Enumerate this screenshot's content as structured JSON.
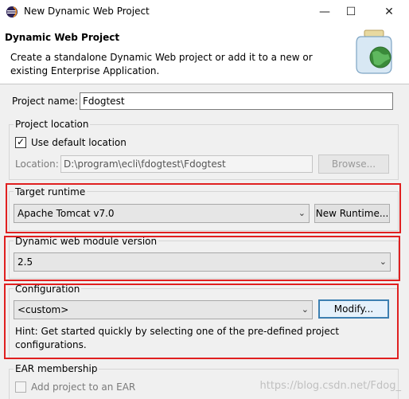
{
  "window": {
    "title": "New Dynamic Web Project",
    "minimize_glyph": "—",
    "maximize_glyph": "☐",
    "close_glyph": "✕"
  },
  "header": {
    "title": "Dynamic Web Project",
    "description": "Create a standalone Dynamic Web project or add it to a new or existing Enterprise Application."
  },
  "project_name": {
    "label": "Project name:",
    "value": "Fdogtest"
  },
  "project_location": {
    "group_title": "Project location",
    "use_default_label": "Use default location",
    "use_default_checked": true,
    "location_label": "Location:",
    "location_value": "D:\\program\\ecli\\fdogtest\\Fdogtest",
    "browse_label": "Browse..."
  },
  "target_runtime": {
    "group_title": "Target runtime",
    "selected": "Apache Tomcat v7.0",
    "new_runtime_label": "New Runtime..."
  },
  "module_version": {
    "group_title": "Dynamic web module version",
    "selected": "2.5"
  },
  "configuration": {
    "group_title": "Configuration",
    "selected": "<custom>",
    "modify_label": "Modify...",
    "hint": "Hint: Get started quickly by selecting one of the pre-defined project configurations."
  },
  "ear": {
    "group_title": "EAR membership",
    "add_label": "Add project to an EAR",
    "checked": false
  },
  "watermark": "https://blog.csdn.net/Fdog_",
  "colors": {
    "highlight_border": "#e02020",
    "focus_border": "#3c7fb1"
  }
}
